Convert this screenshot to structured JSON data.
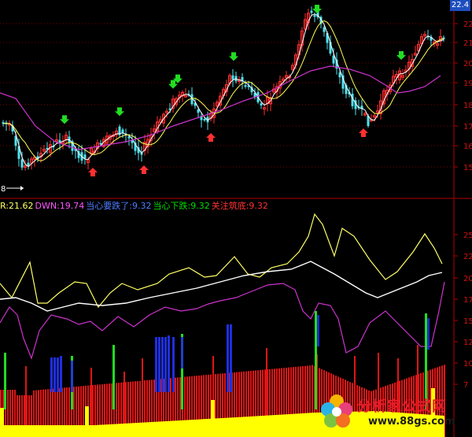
{
  "chart_data": [
    {
      "type": "candlestick",
      "y_ticks": [
        "22",
        "21",
        "20",
        "19",
        "18",
        "17",
        "16",
        "15"
      ],
      "corner_value": "22.4",
      "left_label": "8",
      "up_arrows_x": [
        118,
        183,
        268,
        462
      ],
      "down_arrows_x": [
        82,
        152,
        220,
        226,
        297,
        403,
        510
      ]
    },
    {
      "type": "line",
      "legend": [
        {
          "text": "R:21.62",
          "color": "#ffff66"
        },
        {
          "text": "DWN:19.74",
          "color": "#ff55ff"
        },
        {
          "text": "当心要跌了:9.32",
          "color": "#4f7dff"
        },
        {
          "text": "当心下跌:9.32",
          "color": "#00dd00"
        },
        {
          "text": "关注筑底:9.32",
          "color": "#ff3333"
        }
      ],
      "y_ticks": [
        "25",
        "22",
        "20",
        "17",
        "15",
        "12",
        "10",
        "7"
      ]
    }
  ],
  "watermark": {
    "title": "分析家公式网",
    "url": "www.88gs.com"
  }
}
